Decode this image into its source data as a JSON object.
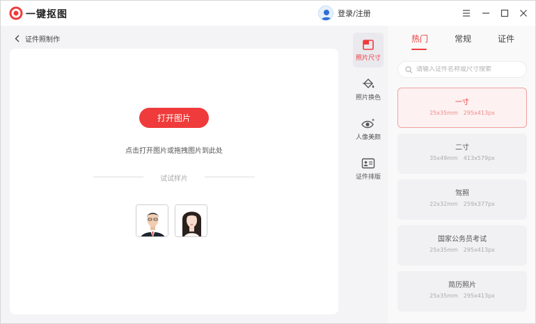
{
  "app": {
    "title": "一键抠图"
  },
  "header": {
    "login_text": "登录/注册"
  },
  "breadcrumb": {
    "label": "证件照制作"
  },
  "upload": {
    "open_button": "打开图片",
    "hint": "点击打开图片或拖拽图片到此处",
    "sample_label": "试试样片"
  },
  "tools": [
    {
      "label": "照片尺寸",
      "icon": "photo-size-icon",
      "active": true
    },
    {
      "label": "照片换色",
      "icon": "paint-bucket-icon",
      "active": false
    },
    {
      "label": "人像美颜",
      "icon": "eye-sparkle-icon",
      "active": false
    },
    {
      "label": "证件排版",
      "icon": "id-card-icon",
      "active": false
    }
  ],
  "tabs": [
    {
      "label": "热门",
      "active": true
    },
    {
      "label": "常规",
      "active": false
    },
    {
      "label": "证件",
      "active": false
    }
  ],
  "search": {
    "placeholder": "请输入证件名称或尺寸搜索"
  },
  "sizes": [
    {
      "name": "一寸",
      "mm": "25x35mm",
      "px": "295x413px",
      "selected": true
    },
    {
      "name": "二寸",
      "mm": "35x49mm",
      "px": "413x579px",
      "selected": false
    },
    {
      "name": "驾照",
      "mm": "22x32mm",
      "px": "259x377px",
      "selected": false
    },
    {
      "name": "国家公务员考试",
      "mm": "25x35mm",
      "px": "295x413px",
      "selected": false
    },
    {
      "name": "简历照片",
      "mm": "25x35mm",
      "px": "295x413px",
      "selected": false
    }
  ],
  "colors": {
    "accent": "#ef3b3b",
    "panel": "#f4f4f6"
  }
}
